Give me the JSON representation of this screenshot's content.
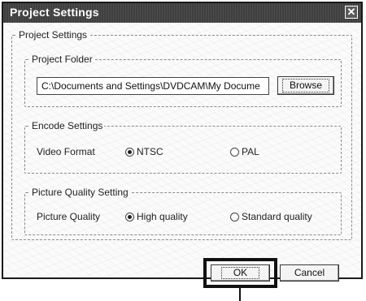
{
  "window": {
    "title": "Project Settings",
    "close_glyph": "✕"
  },
  "groups": {
    "project_settings": "Project Settings",
    "project_folder": "Project Folder",
    "encode_settings": "Encode Settings",
    "picture_quality_setting": "Picture Quality Setting"
  },
  "project_folder": {
    "path_value": "C:\\Documents and Settings\\DVDCAM\\My Docume",
    "browse_label": "Browse"
  },
  "encode": {
    "video_format_label": "Video Format",
    "options": [
      {
        "label": "NTSC",
        "checked": true
      },
      {
        "label": "PAL",
        "checked": false
      }
    ]
  },
  "quality": {
    "picture_quality_label": "Picture Quality",
    "options": [
      {
        "label": "High quality",
        "checked": true
      },
      {
        "label": "Standard quality",
        "checked": false
      }
    ]
  },
  "buttons": {
    "ok_label": "OK",
    "cancel_label": "Cancel"
  }
}
